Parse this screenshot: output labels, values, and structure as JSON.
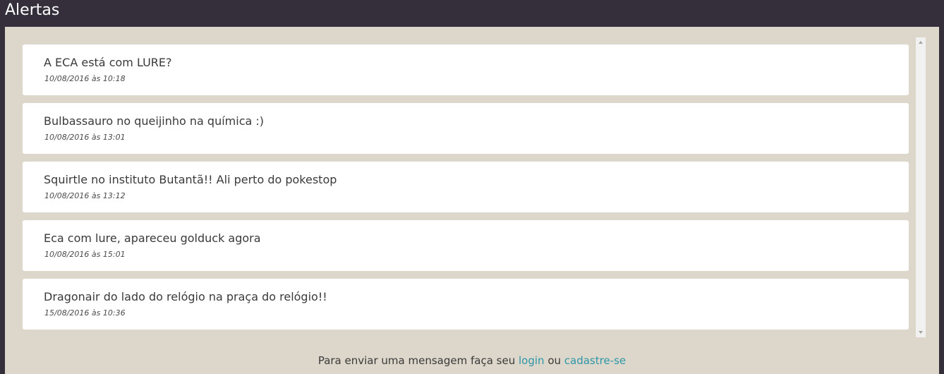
{
  "header": {
    "title": "Alertas"
  },
  "alerts": [
    {
      "title": "A ECA está com LURE?",
      "time": "10/08/2016 às 10:18"
    },
    {
      "title": "Bulbassauro no queijinho na química :)",
      "time": "10/08/2016 às 13:01"
    },
    {
      "title": "Squirtle no instituto Butantã!! Ali perto do pokestop",
      "time": "10/08/2016 às 13:12"
    },
    {
      "title": "Eca com lure, apareceu golduck agora",
      "time": "10/08/2016 às 15:01"
    },
    {
      "title": "Dragonair do lado do relógio na praça do relógio!!",
      "time": "15/08/2016 às 10:36"
    }
  ],
  "footer": {
    "text_before": "Para enviar uma mensagem faça seu ",
    "login_link": "login",
    "text_middle": " ou ",
    "signup_link": "cadastre-se"
  },
  "colors": {
    "header_bg": "#342f3a",
    "panel_bg": "#ddd6ca",
    "link": "#2e97a8"
  }
}
